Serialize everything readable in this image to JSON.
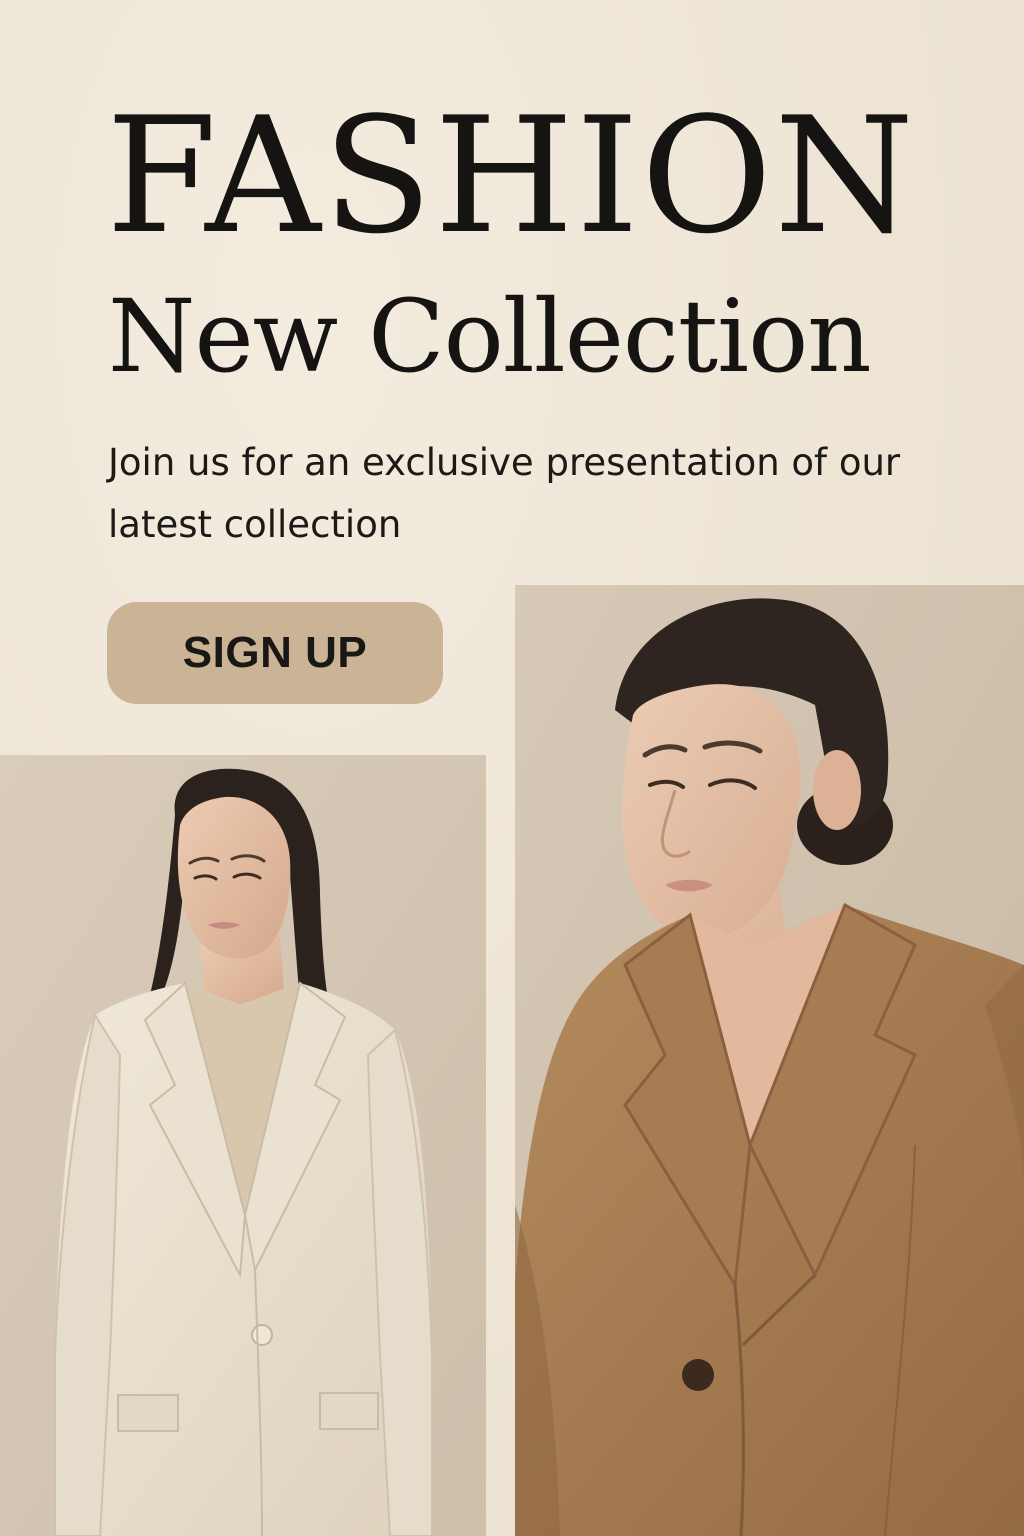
{
  "poster": {
    "title": "FASHION",
    "subtitle": "New Collection",
    "description": "Join us for an exclusive presentation of our latest collection",
    "cta_label": "SIGN UP"
  },
  "colors": {
    "background": "#efe7d8",
    "text": "#151412",
    "button": "#cbb396",
    "cream_blazer": "#ece2d0",
    "camel_blazer": "#a77c52"
  },
  "images": {
    "left": "model-in-cream-blazer",
    "right": "model-in-camel-blazer"
  }
}
